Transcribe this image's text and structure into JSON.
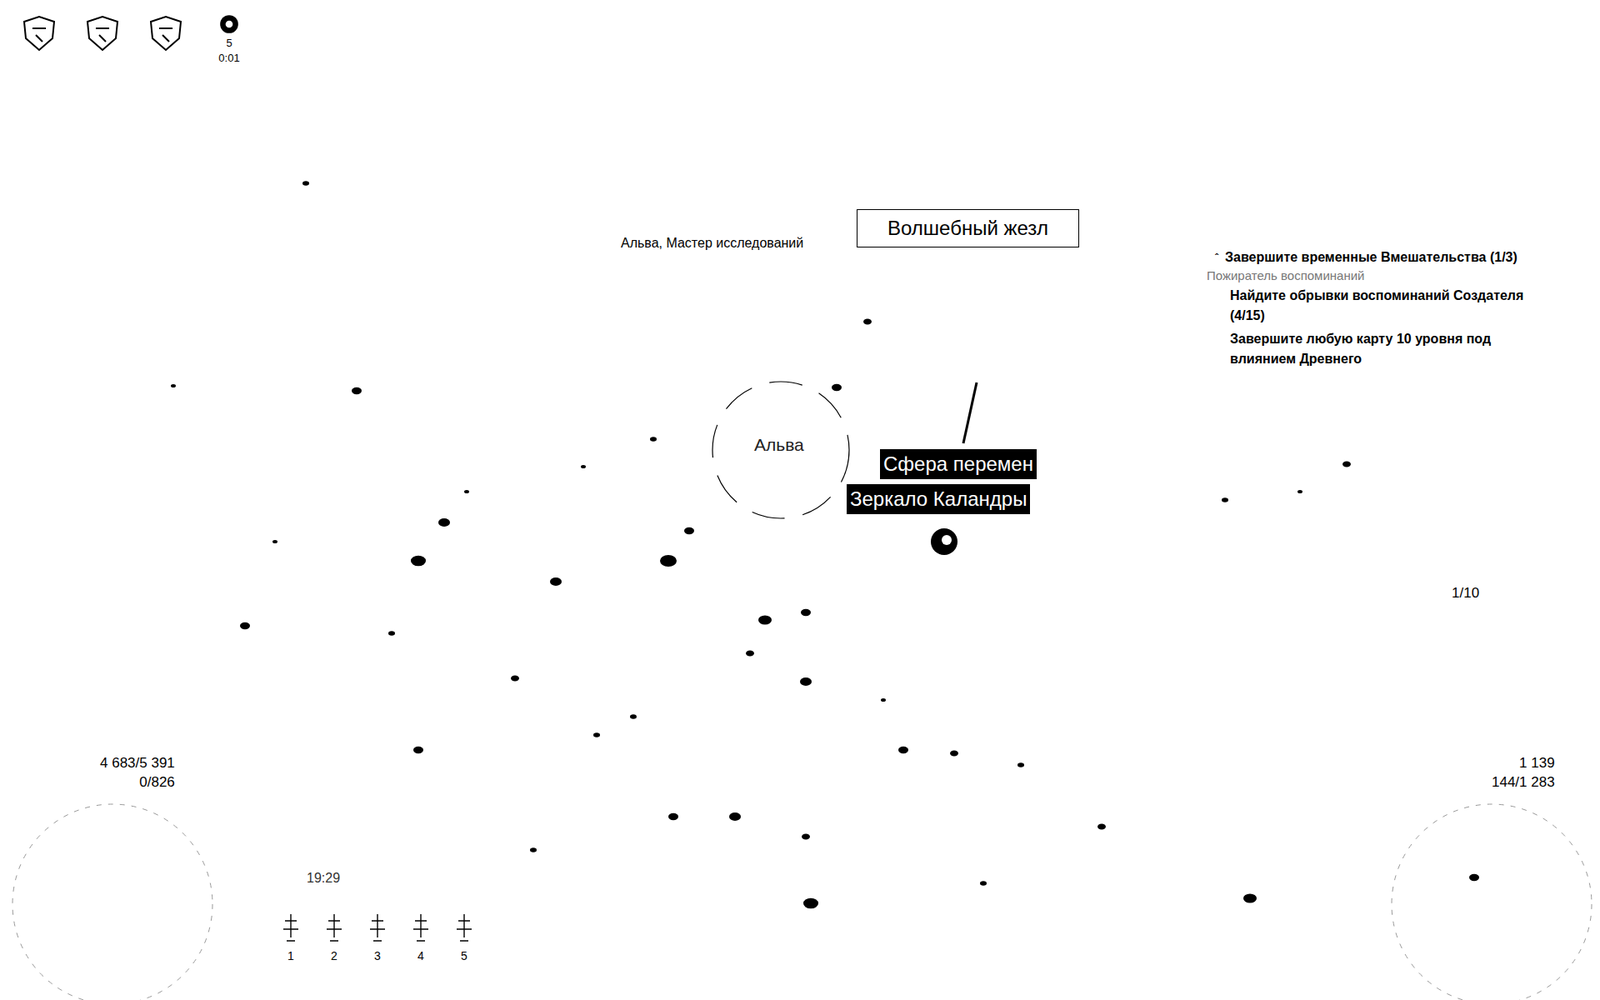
{
  "buff_bar": {
    "buffs": [
      {
        "stack": "",
        "timer": ""
      },
      {
        "stack": "",
        "timer": ""
      },
      {
        "stack": "",
        "timer": ""
      },
      {
        "stack": "5",
        "timer": "0:01"
      }
    ]
  },
  "npc": {
    "title": "Альва, Мастер исследований",
    "name": "Альва"
  },
  "hovered_item": {
    "name": "Волшебный жезл"
  },
  "ground_items": [
    {
      "name": "Сфера перемен"
    },
    {
      "name": "Зеркало Каландры"
    }
  ],
  "quest_tracker": {
    "expanded": true,
    "toggle": "ˆ",
    "title": "Завершите временные Вмешательства (1/3)",
    "subtitle": "Пожиратель воспоминаний",
    "tasks": [
      "Найдите обрывки воспоминаний Создателя (4/15)",
      "Завершите любую карту 10 уровня под влиянием Древнего"
    ]
  },
  "counter": "1/10",
  "life": {
    "value": "4 683/5 391",
    "shield": "0/826"
  },
  "mana": {
    "value": "1 139",
    "spirit": "144/1 283"
  },
  "clock": "19:29",
  "skill_slots": [
    "1",
    "2",
    "3",
    "4",
    "5"
  ]
}
